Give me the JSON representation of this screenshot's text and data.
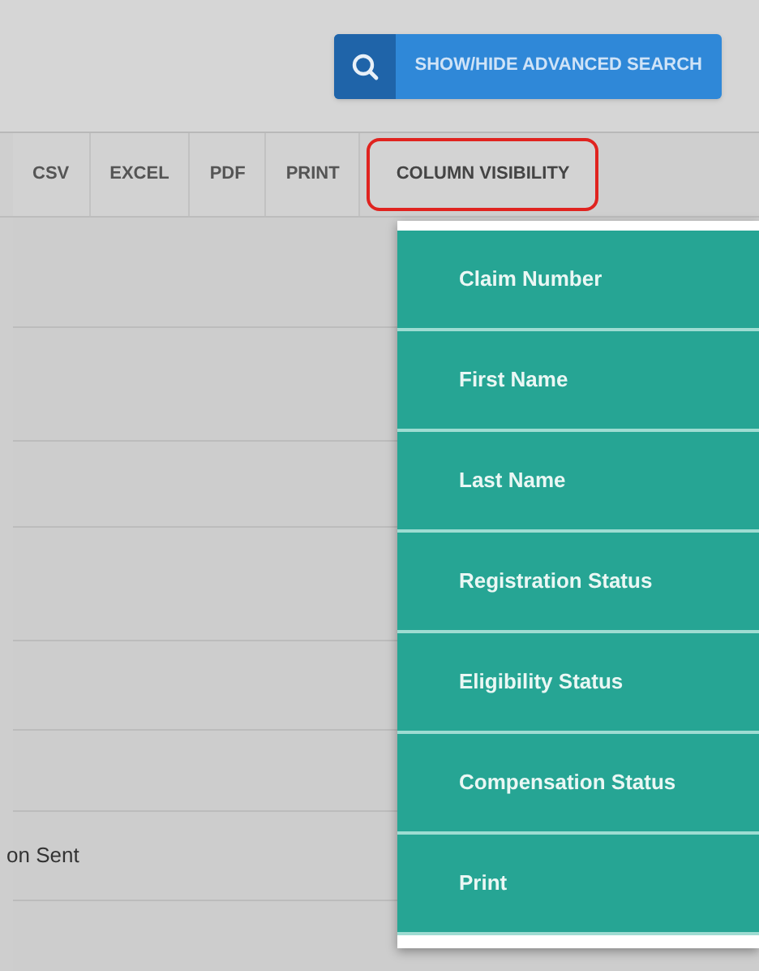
{
  "search_button": {
    "label": "SHOW/HIDE ADVANCED SEARCH"
  },
  "toolbar": {
    "buttons": [
      {
        "label": "CSV",
        "selected": false
      },
      {
        "label": "EXCEL",
        "selected": false
      },
      {
        "label": "PDF",
        "selected": false
      },
      {
        "label": "PRINT",
        "selected": false
      },
      {
        "label": "COLUMN VISIBILITY",
        "selected": true
      }
    ]
  },
  "table": {
    "partial_cell": "on Sent"
  },
  "column_menu": {
    "items": [
      "Claim Number",
      "First Name",
      "Last Name",
      "Registration Status",
      "Eligibility Status",
      "Compensation Status",
      "Print"
    ]
  }
}
